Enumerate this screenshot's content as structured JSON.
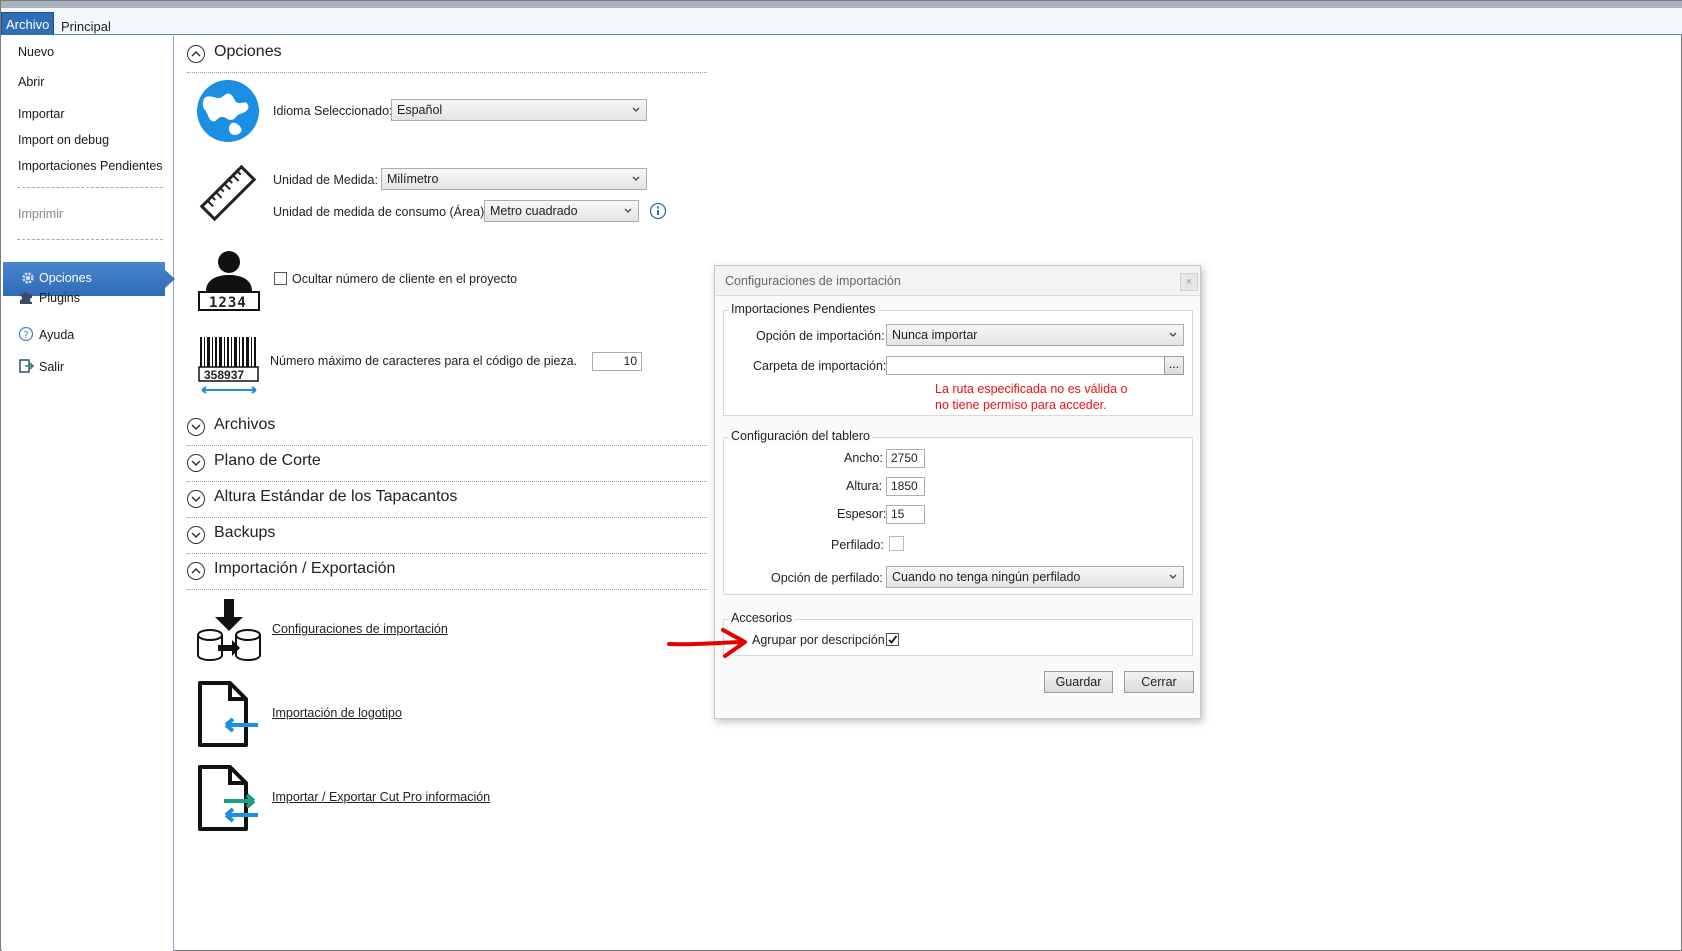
{
  "ribbon": {
    "tabs": [
      "Archivo",
      "Principal"
    ]
  },
  "sidebar": {
    "items": [
      "Nuevo",
      "Abrir",
      "Importar",
      "Import on debug",
      "Importaciones Pendientes",
      "Imprimir"
    ],
    "active": "Opciones",
    "nav": [
      "Plugins",
      "Ayuda",
      "Salir"
    ]
  },
  "sections": {
    "opciones": "Opciones",
    "archivos": "Archivos",
    "plano": "Plano de Corte",
    "altura": "Altura Estándar de los Tapacantos",
    "backups": "Backups",
    "impexp": "Importación / Exportación"
  },
  "options": {
    "idioma_label": "Idioma Seleccionado:",
    "idioma_value": "Español",
    "unidad_label": "Unidad de Medida:",
    "unidad_value": "Milímetro",
    "consumo_label": "Unidad de medida de consumo (Área):",
    "consumo_value": "Metro cuadrado",
    "ocultar_label": "Ocultar número de cliente en el proyecto",
    "client_number": "1234",
    "barcode_number": "358937",
    "maxchar_label": "Número máximo de caracteres para el código de pieza.",
    "maxchar_value": "10"
  },
  "impexp": {
    "link1": "Configuraciones de importación",
    "link2": "Importación de logotipo",
    "link3": "Importar / Exportar Cut Pro información"
  },
  "dialog": {
    "title": "Configuraciones de importación",
    "close": "×",
    "pend_title": "Importaciones Pendientes",
    "opcion_label": "Opción de importación:",
    "opcion_value": "Nunca importar",
    "carpeta_label": "Carpeta de importación:",
    "carpeta_value": "",
    "browse": "...",
    "error_line1": "La ruta especificada no es válida o",
    "error_line2": "no tiene permiso para acceder.",
    "tablero_title": "Configuración del tablero",
    "ancho_label": "Ancho:",
    "ancho_value": "2750",
    "altura_label": "Altura:",
    "altura_value": "1850",
    "espesor_label": "Espesor:",
    "espesor_value": "15",
    "perfilado_label": "Perfilado:",
    "opc_perf_label": "Opción de perfilado:",
    "opc_perf_value": "Cuando no tenga ningún perfilado",
    "acc_title": "Accesorios",
    "agrupar_label": "Agrupar por descripción",
    "guardar": "Guardar",
    "cerrar": "Cerrar"
  },
  "colors": {
    "accent": "#2f6db5",
    "error": "#ee1111",
    "annotation_arrow": "#e30000"
  }
}
